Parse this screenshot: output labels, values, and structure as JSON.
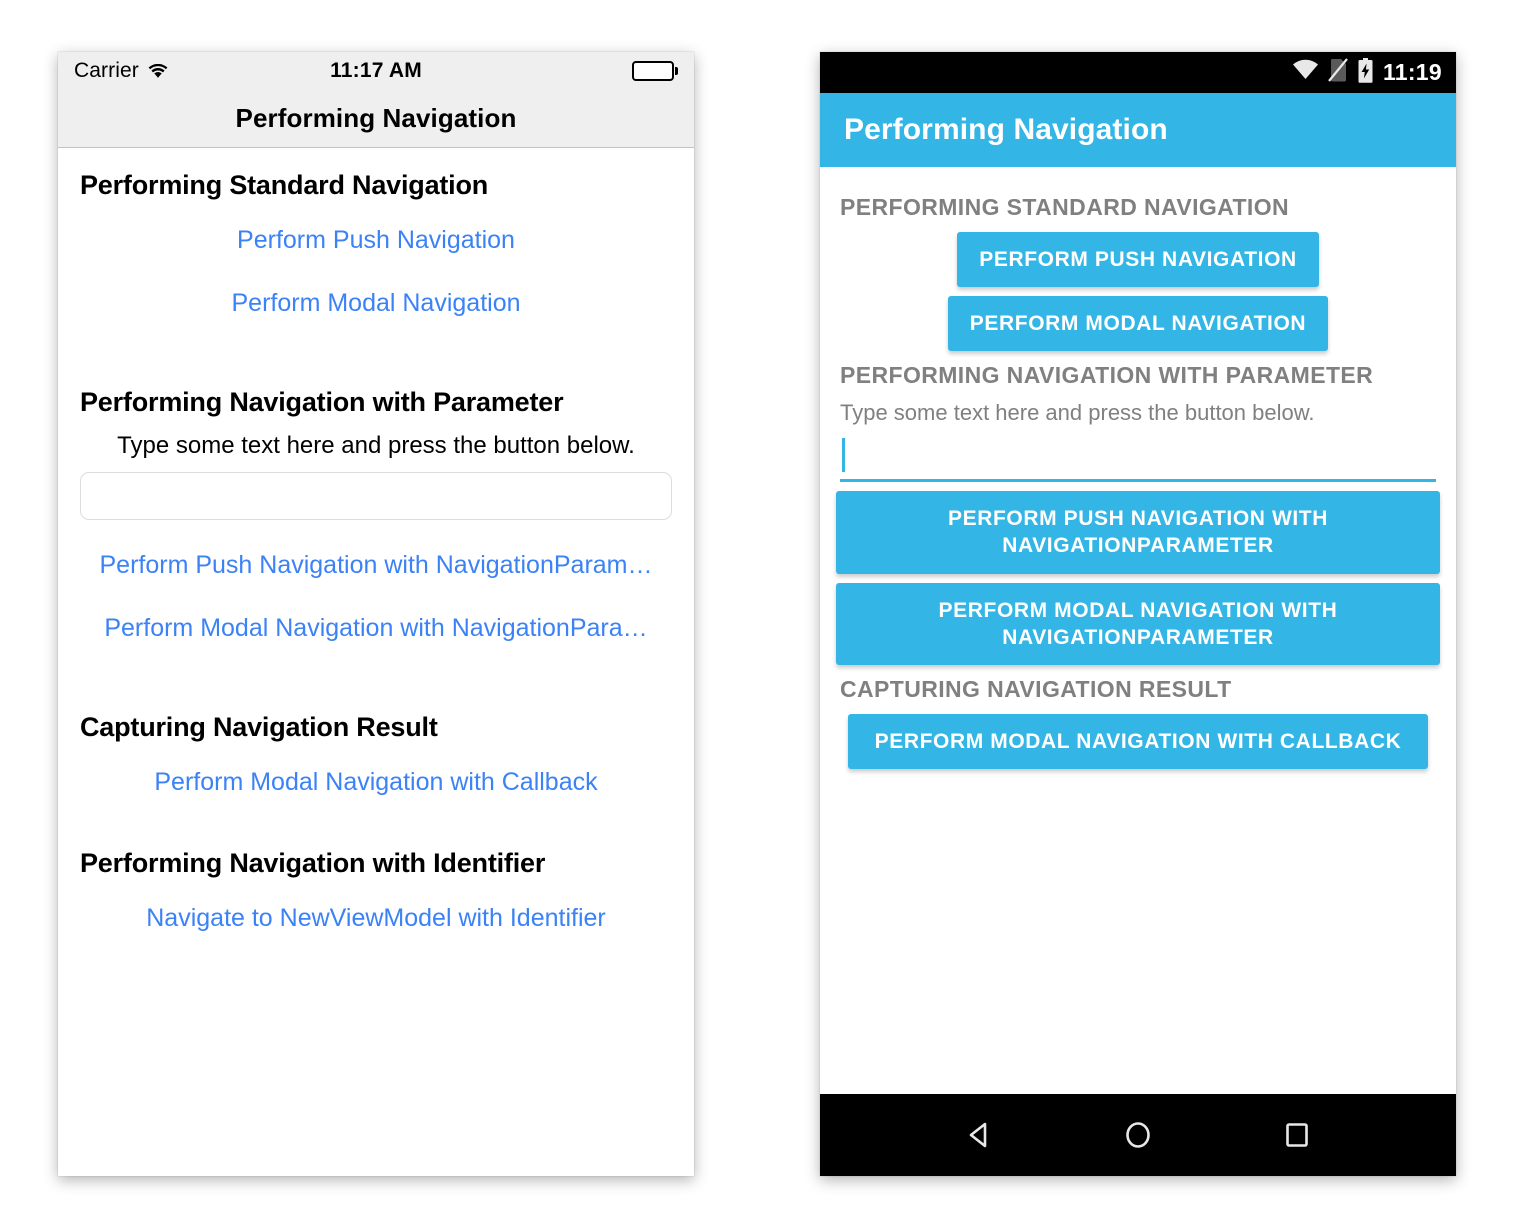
{
  "ios": {
    "status": {
      "carrier": "Carrier",
      "wifi_icon": "wifi-icon",
      "time": "11:17 AM",
      "battery_icon": "battery-full-icon"
    },
    "navbar": {
      "title": "Performing Navigation"
    },
    "sections": [
      {
        "heading": "Performing Standard Navigation",
        "links": [
          "Perform Push Navigation",
          "Perform Modal Navigation"
        ]
      },
      {
        "heading": "Performing Navigation with Parameter",
        "subtext": "Type some text here and press the button below.",
        "input": {
          "value": "",
          "placeholder": ""
        },
        "links": [
          "Perform Push Navigation with NavigationParam…",
          "Perform Modal Navigation with NavigationPara…"
        ]
      },
      {
        "heading": "Capturing Navigation Result",
        "links": [
          "Perform Modal Navigation with Callback"
        ]
      },
      {
        "heading": "Performing Navigation with Identifier",
        "links": [
          "Navigate to NewViewModel with Identifier"
        ]
      }
    ]
  },
  "android": {
    "status": {
      "wifi_icon": "wifi-icon",
      "sim_icon": "no-sim-icon",
      "battery_icon": "battery-charging-icon",
      "time": "11:19"
    },
    "appbar": {
      "title": "Performing Navigation"
    },
    "sections": [
      {
        "heading": "PERFORMING STANDARD NAVIGATION",
        "buttons": [
          "PERFORM PUSH NAVIGATION",
          "PERFORM MODAL NAVIGATION"
        ]
      },
      {
        "heading": "PERFORMING NAVIGATION WITH PARAMETER",
        "subtext": "Type some text here and press the button below.",
        "input": {
          "value": "",
          "placeholder": ""
        },
        "buttons": [
          "PERFORM PUSH NAVIGATION WITH NAVIGATIONPARAMETER",
          "PERFORM MODAL NAVIGATION WITH NAVIGATIONPARAMETER"
        ]
      },
      {
        "heading": "CAPTURING NAVIGATION RESULT",
        "buttons": [
          "PERFORM MODAL NAVIGATION WITH CALLBACK"
        ]
      }
    ],
    "navbar": {
      "back_icon": "back-triangle-icon",
      "home_icon": "home-circle-icon",
      "recents_icon": "recents-square-icon"
    }
  },
  "colors": {
    "android_accent": "#33b5e5",
    "ios_link": "#3b82f6",
    "ios_chrome": "#efeff0",
    "android_heading": "#808080"
  }
}
